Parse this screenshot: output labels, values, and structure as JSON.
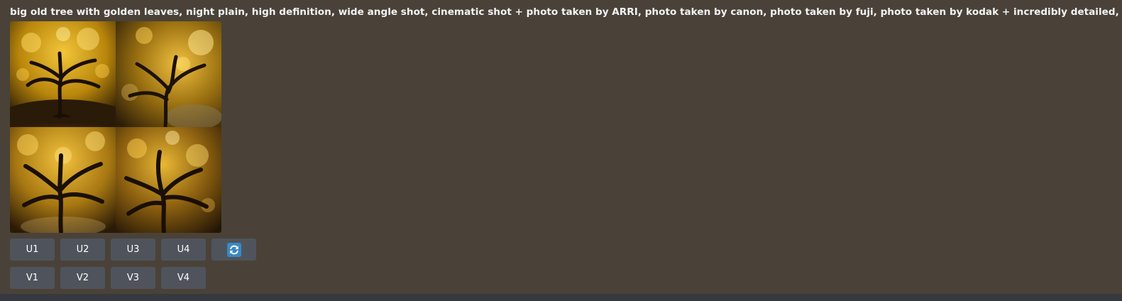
{
  "message": {
    "prompt_text": "big old tree with golden leaves, night plain, high definition, wide angle shot, cinematic shot + photo taken by ARRI, photo taken by canon, photo taken by fuji, photo taken by kodak + incredibly detailed, professional lighting -"
  },
  "image_grid": {
    "tiles": [
      {
        "icon": "golden-tree-image-1"
      },
      {
        "icon": "golden-tree-image-2"
      },
      {
        "icon": "golden-tree-image-3"
      },
      {
        "icon": "golden-tree-image-4"
      }
    ]
  },
  "buttons": {
    "upscale": [
      "U1",
      "U2",
      "U3",
      "U4"
    ],
    "variation": [
      "V1",
      "V2",
      "V3",
      "V4"
    ],
    "reroll_icon": "refresh-icon"
  },
  "colors": {
    "background": "#4a4238",
    "button": "#4f545c",
    "refresh_icon": "#3b88c3",
    "bottom_bar": "#36393f"
  }
}
